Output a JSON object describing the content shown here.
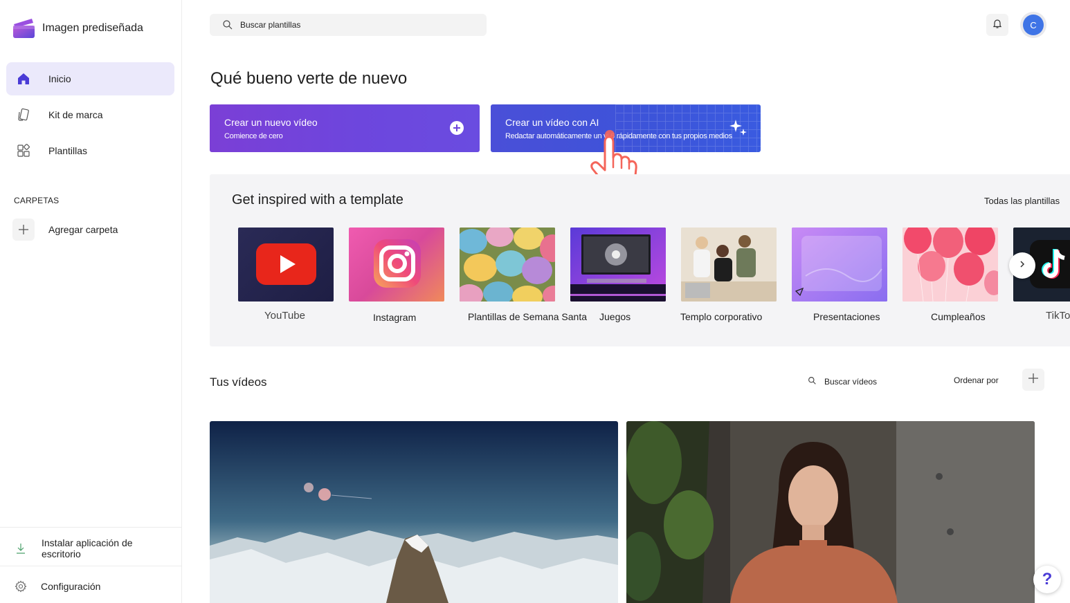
{
  "app": {
    "name": "Imagen prediseñada"
  },
  "sidebar": {
    "items": [
      {
        "label": "Inicio",
        "icon": "home-icon",
        "active": true
      },
      {
        "label": "Kit de marca",
        "icon": "brand-kit-icon",
        "active": false
      },
      {
        "label": "Plantillas",
        "icon": "templates-icon",
        "active": false
      }
    ],
    "folders_heading": "CARPETAS",
    "add_folder_label": "Agregar carpeta",
    "install_label": "Instalar aplicación de escritorio",
    "settings_label": "Configuración"
  },
  "header": {
    "search_placeholder": "Buscar plantillas",
    "avatar_initial": "C"
  },
  "main": {
    "welcome": "Qué bueno verte de nuevo",
    "cta_new": {
      "title": "Crear un nuevo vídeo",
      "subtitle": "Comience de cero"
    },
    "cta_ai": {
      "title": "Crear un vídeo con AI",
      "subtitle": "Redactar automáticamente un vi 6 rápidamente con tus propios medios"
    }
  },
  "templates": {
    "heading": "Get inspired with a template",
    "all_label": "Todas las plantillas",
    "items": [
      {
        "label": "YouTube"
      },
      {
        "label": "Instagram"
      },
      {
        "label": "Plantillas de Semana Santa"
      },
      {
        "label": "Juegos"
      },
      {
        "label": "Templo corporativo"
      },
      {
        "label": "Presentaciones"
      },
      {
        "label": "Cumpleaños"
      },
      {
        "label": "TikTo"
      }
    ]
  },
  "videos": {
    "heading": "Tus vídeos",
    "search_placeholder": "Buscar vídeos",
    "sort_label": "Ordenar por"
  },
  "help": {
    "label": "?"
  },
  "colors": {
    "accent": "#5b4ce0",
    "active_nav_bg": "#ebe9fb",
    "cta_new": "#7346dc",
    "cta_ai": "#3f55da"
  }
}
